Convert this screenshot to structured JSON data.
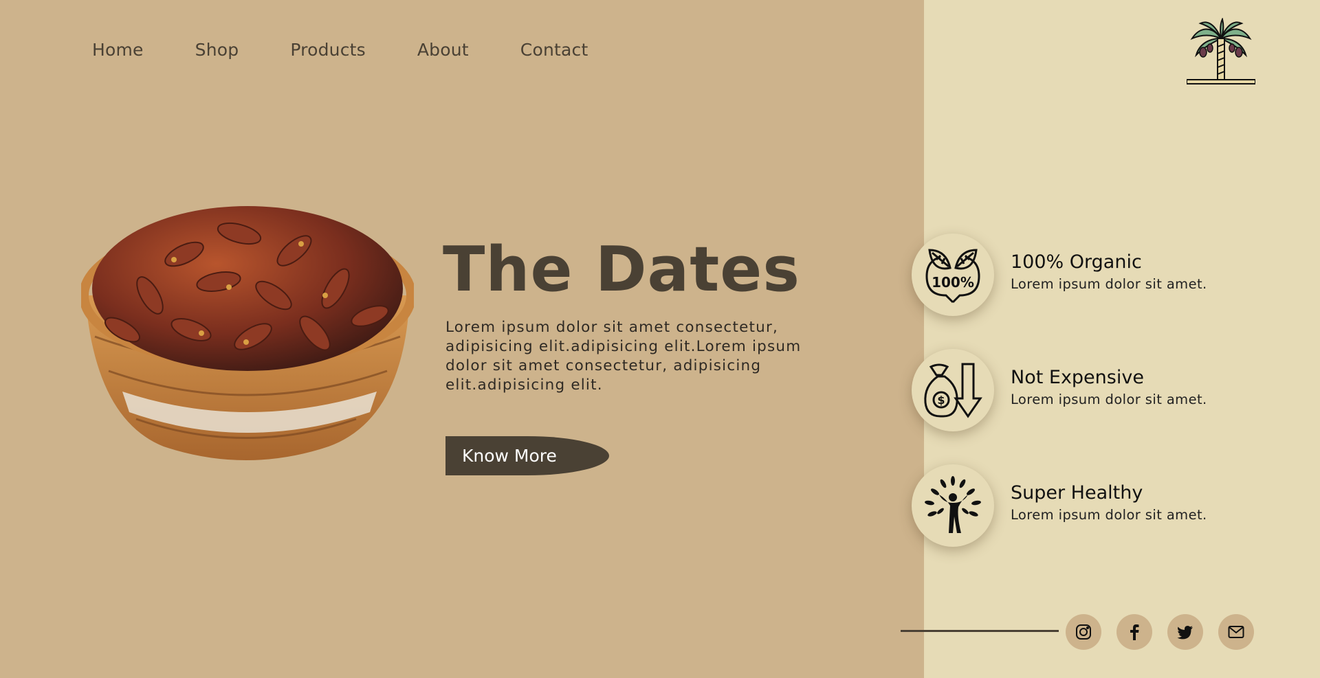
{
  "nav": {
    "items": [
      {
        "label": "Home"
      },
      {
        "label": "Shop"
      },
      {
        "label": "Products"
      },
      {
        "label": "About"
      },
      {
        "label": "Contact"
      }
    ]
  },
  "logo": {
    "icon": "date-palm-tree-icon"
  },
  "hero": {
    "title": "The Dates",
    "text": "Lorem ipsum dolor sit amet consectetur, adipisicing elit.adipisicing elit.Lorem ipsum dolor sit amet consectetur, adipisicing elit.adipisicing elit.",
    "button_label": "Know More",
    "image": "basket-of-dates"
  },
  "features": [
    {
      "icon": "organic-100-icon",
      "title": "100% Organic",
      "desc": "Lorem ipsum dolor sit amet."
    },
    {
      "icon": "money-bag-down-arrow-icon",
      "title": "Not Expensive",
      "desc": "Lorem ipsum dolor sit amet."
    },
    {
      "icon": "healthy-person-tree-icon",
      "title": "Super Healthy",
      "desc": "Lorem ipsum dolor sit amet."
    }
  ],
  "social": [
    {
      "icon": "instagram-icon"
    },
    {
      "icon": "facebook-icon"
    },
    {
      "icon": "twitter-icon"
    },
    {
      "icon": "email-icon"
    }
  ],
  "colors": {
    "left_bg": "#cdb38c",
    "right_bg": "#e6dbb6",
    "dark": "#4a4134"
  }
}
